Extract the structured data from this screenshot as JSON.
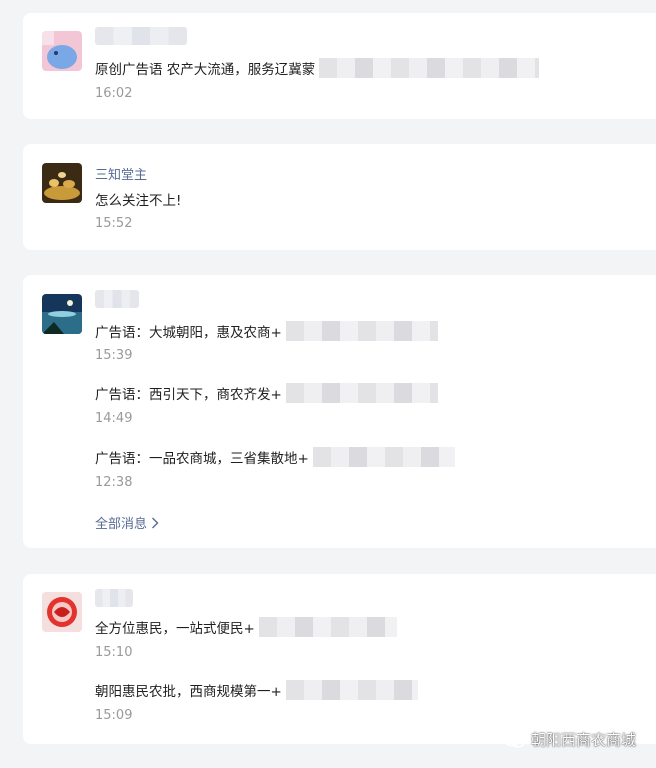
{
  "comments": [
    {
      "name": "",
      "messages": [
        {
          "text": "原创广告语 农产大流通，服务辽冀蒙",
          "time": "16:02"
        }
      ]
    },
    {
      "name": "三知堂主",
      "messages": [
        {
          "text": "怎么关注不上!",
          "time": "15:52"
        }
      ]
    },
    {
      "name": "",
      "messages": [
        {
          "text": "广告语：大城朝阳，惠及农商+",
          "time": "15:39"
        },
        {
          "text": "广告语：西引天下，商农齐发+",
          "time": "14:49"
        },
        {
          "text": "广告语：一品农商城，三省集散地+",
          "time": "12:38"
        }
      ],
      "all_messages_label": "全部消息"
    },
    {
      "name": "",
      "messages": [
        {
          "text": "全方位惠民，一站式便民+",
          "time": "15:10"
        },
        {
          "text": "朝阳惠民农批，西商规模第一+",
          "time": "15:09"
        }
      ]
    }
  ],
  "watermark": {
    "text": "朝阳西商农商城"
  },
  "colors": {
    "link": "#576b95",
    "time": "#9a9a9a",
    "background": "#f3f4f6"
  }
}
